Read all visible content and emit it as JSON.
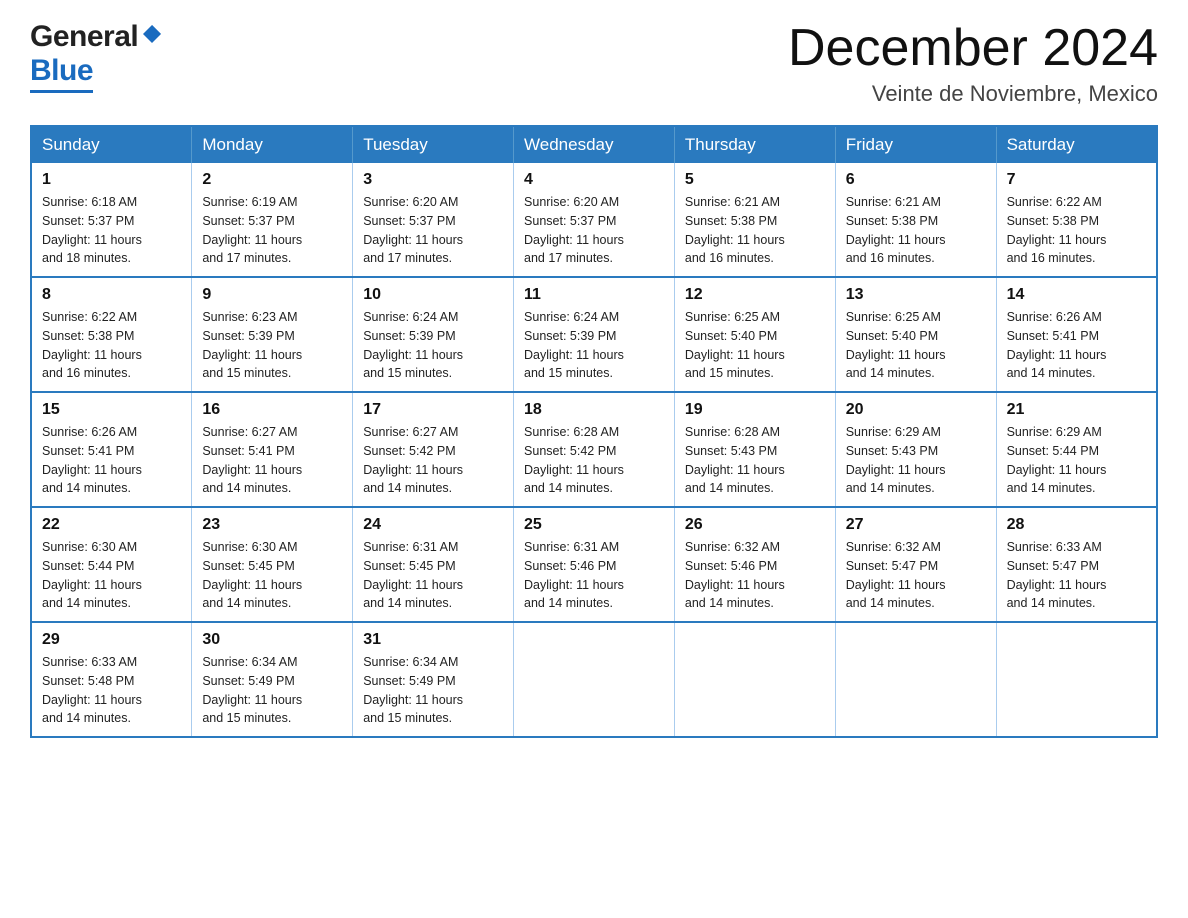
{
  "header": {
    "logo_general": "General",
    "logo_blue": "Blue",
    "month_title": "December 2024",
    "location": "Veinte de Noviembre, Mexico"
  },
  "days_of_week": [
    "Sunday",
    "Monday",
    "Tuesday",
    "Wednesday",
    "Thursday",
    "Friday",
    "Saturday"
  ],
  "weeks": [
    [
      {
        "day": "1",
        "sunrise": "6:18 AM",
        "sunset": "5:37 PM",
        "daylight": "11 hours and 18 minutes."
      },
      {
        "day": "2",
        "sunrise": "6:19 AM",
        "sunset": "5:37 PM",
        "daylight": "11 hours and 17 minutes."
      },
      {
        "day": "3",
        "sunrise": "6:20 AM",
        "sunset": "5:37 PM",
        "daylight": "11 hours and 17 minutes."
      },
      {
        "day": "4",
        "sunrise": "6:20 AM",
        "sunset": "5:37 PM",
        "daylight": "11 hours and 17 minutes."
      },
      {
        "day": "5",
        "sunrise": "6:21 AM",
        "sunset": "5:38 PM",
        "daylight": "11 hours and 16 minutes."
      },
      {
        "day": "6",
        "sunrise": "6:21 AM",
        "sunset": "5:38 PM",
        "daylight": "11 hours and 16 minutes."
      },
      {
        "day": "7",
        "sunrise": "6:22 AM",
        "sunset": "5:38 PM",
        "daylight": "11 hours and 16 minutes."
      }
    ],
    [
      {
        "day": "8",
        "sunrise": "6:22 AM",
        "sunset": "5:38 PM",
        "daylight": "11 hours and 16 minutes."
      },
      {
        "day": "9",
        "sunrise": "6:23 AM",
        "sunset": "5:39 PM",
        "daylight": "11 hours and 15 minutes."
      },
      {
        "day": "10",
        "sunrise": "6:24 AM",
        "sunset": "5:39 PM",
        "daylight": "11 hours and 15 minutes."
      },
      {
        "day": "11",
        "sunrise": "6:24 AM",
        "sunset": "5:39 PM",
        "daylight": "11 hours and 15 minutes."
      },
      {
        "day": "12",
        "sunrise": "6:25 AM",
        "sunset": "5:40 PM",
        "daylight": "11 hours and 15 minutes."
      },
      {
        "day": "13",
        "sunrise": "6:25 AM",
        "sunset": "5:40 PM",
        "daylight": "11 hours and 14 minutes."
      },
      {
        "day": "14",
        "sunrise": "6:26 AM",
        "sunset": "5:41 PM",
        "daylight": "11 hours and 14 minutes."
      }
    ],
    [
      {
        "day": "15",
        "sunrise": "6:26 AM",
        "sunset": "5:41 PM",
        "daylight": "11 hours and 14 minutes."
      },
      {
        "day": "16",
        "sunrise": "6:27 AM",
        "sunset": "5:41 PM",
        "daylight": "11 hours and 14 minutes."
      },
      {
        "day": "17",
        "sunrise": "6:27 AM",
        "sunset": "5:42 PM",
        "daylight": "11 hours and 14 minutes."
      },
      {
        "day": "18",
        "sunrise": "6:28 AM",
        "sunset": "5:42 PM",
        "daylight": "11 hours and 14 minutes."
      },
      {
        "day": "19",
        "sunrise": "6:28 AM",
        "sunset": "5:43 PM",
        "daylight": "11 hours and 14 minutes."
      },
      {
        "day": "20",
        "sunrise": "6:29 AM",
        "sunset": "5:43 PM",
        "daylight": "11 hours and 14 minutes."
      },
      {
        "day": "21",
        "sunrise": "6:29 AM",
        "sunset": "5:44 PM",
        "daylight": "11 hours and 14 minutes."
      }
    ],
    [
      {
        "day": "22",
        "sunrise": "6:30 AM",
        "sunset": "5:44 PM",
        "daylight": "11 hours and 14 minutes."
      },
      {
        "day": "23",
        "sunrise": "6:30 AM",
        "sunset": "5:45 PM",
        "daylight": "11 hours and 14 minutes."
      },
      {
        "day": "24",
        "sunrise": "6:31 AM",
        "sunset": "5:45 PM",
        "daylight": "11 hours and 14 minutes."
      },
      {
        "day": "25",
        "sunrise": "6:31 AM",
        "sunset": "5:46 PM",
        "daylight": "11 hours and 14 minutes."
      },
      {
        "day": "26",
        "sunrise": "6:32 AM",
        "sunset": "5:46 PM",
        "daylight": "11 hours and 14 minutes."
      },
      {
        "day": "27",
        "sunrise": "6:32 AM",
        "sunset": "5:47 PM",
        "daylight": "11 hours and 14 minutes."
      },
      {
        "day": "28",
        "sunrise": "6:33 AM",
        "sunset": "5:47 PM",
        "daylight": "11 hours and 14 minutes."
      }
    ],
    [
      {
        "day": "29",
        "sunrise": "6:33 AM",
        "sunset": "5:48 PM",
        "daylight": "11 hours and 14 minutes."
      },
      {
        "day": "30",
        "sunrise": "6:34 AM",
        "sunset": "5:49 PM",
        "daylight": "11 hours and 15 minutes."
      },
      {
        "day": "31",
        "sunrise": "6:34 AM",
        "sunset": "5:49 PM",
        "daylight": "11 hours and 15 minutes."
      },
      null,
      null,
      null,
      null
    ]
  ],
  "labels": {
    "sunrise": "Sunrise:",
    "sunset": "Sunset:",
    "daylight": "Daylight:"
  }
}
